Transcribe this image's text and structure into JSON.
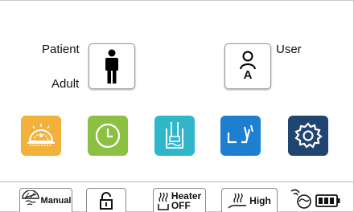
{
  "patient": {
    "label": "Patient",
    "mode": "Adult"
  },
  "user": {
    "label": "User",
    "badge": "A"
  },
  "tiles": [
    {
      "name": "alarm-tile",
      "icon": "alarm-light-icon",
      "color": "#f2b13a"
    },
    {
      "name": "history-tile",
      "icon": "clock-icon",
      "color": "#8cc043"
    },
    {
      "name": "reservoir-tile",
      "icon": "water-chamber-icon",
      "color": "#2fb6c9"
    },
    {
      "name": "bed-tile",
      "icon": "bed-adjust-icon",
      "color": "#1e7fd1"
    },
    {
      "name": "settings-tile",
      "icon": "gear-icon",
      "color": "#1f4570"
    }
  ],
  "bottom_bar": {
    "mode_label": "Manual",
    "lock_icon": "unlock-icon",
    "heater_label": "Heater",
    "heater_state": "OFF",
    "level_label": "High",
    "battery_icon": "battery-icon"
  }
}
